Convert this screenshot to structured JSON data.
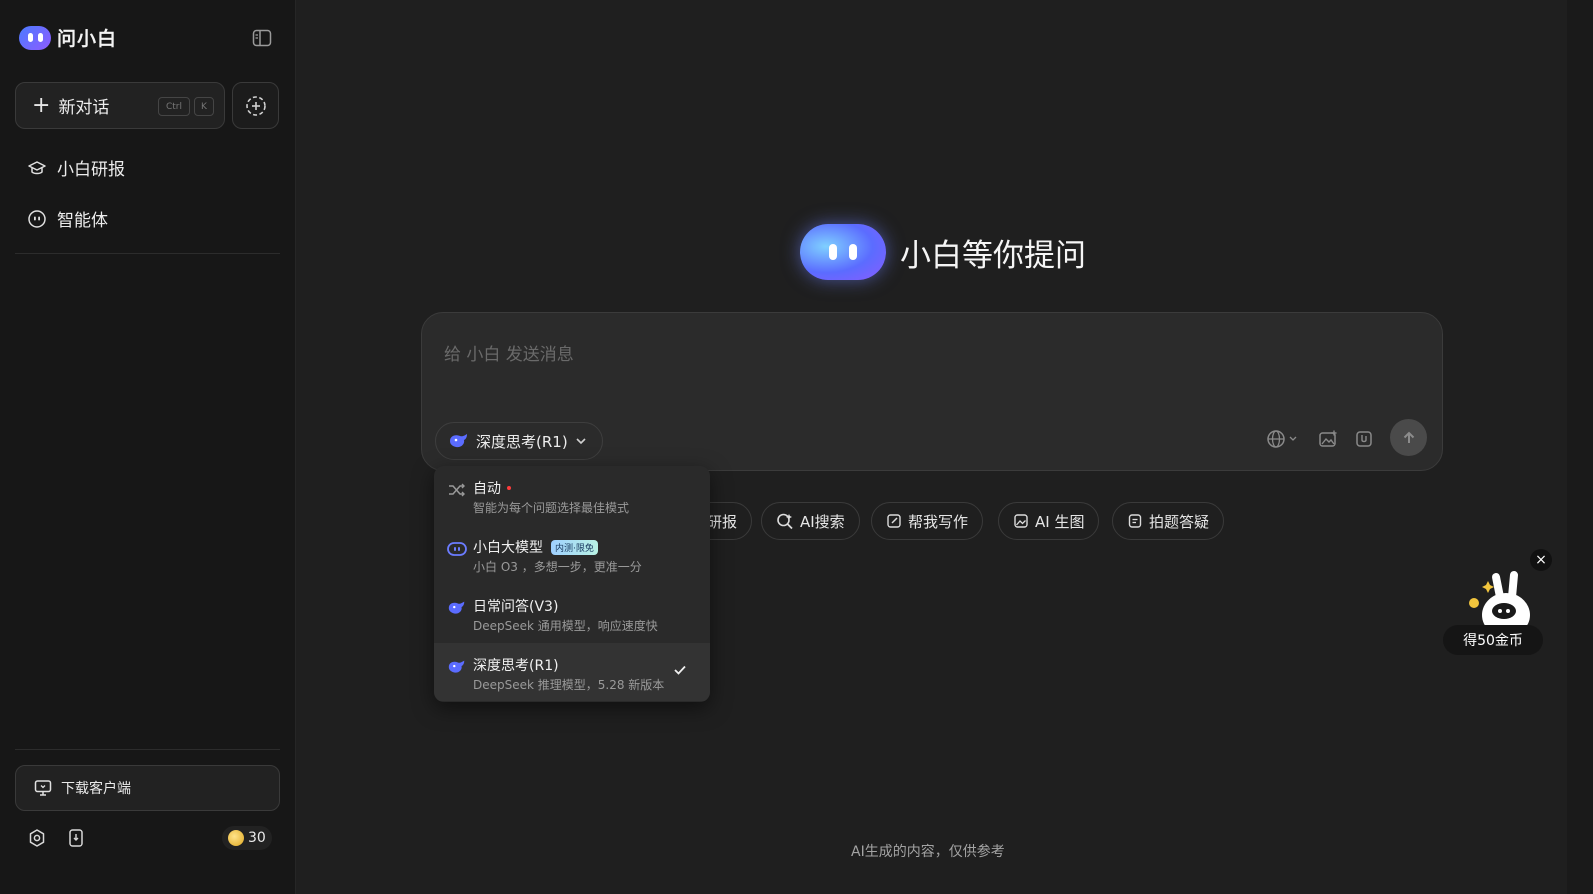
{
  "app": {
    "name": "问小白"
  },
  "sidebar": {
    "new_chat": {
      "label": "新对话",
      "shortcut_ctrl": "Ctrl",
      "shortcut_key": "K"
    },
    "items": [
      {
        "label": "小白研报",
        "icon": "graduation-cap-icon"
      },
      {
        "label": "智能体",
        "icon": "agent-face-icon"
      }
    ],
    "download_label": "下载客户端",
    "coins": "30"
  },
  "main": {
    "hero_title": "小白等你提问",
    "input_placeholder": "给 小白 发送消息",
    "selected_model": "深度思考(R1)",
    "chips": [
      "研报",
      "AI搜索",
      "帮我写作",
      "AI 生图",
      "拍题答疑"
    ],
    "footer_note": "AI生成的内容，仅供参考"
  },
  "model_menu": {
    "options": [
      {
        "title": "自动",
        "desc": "智能为每个问题选择最佳模式",
        "icon": "shuffle-icon",
        "new_dot": true
      },
      {
        "title": "小白大模型",
        "badge": "内测·限免",
        "desc": "小白 O3 ，多想一步，更准一分",
        "icon": "xiaobai-logo-icon"
      },
      {
        "title": "日常问答(V3)",
        "desc": "DeepSeek 通用模型，响应速度快",
        "icon": "deepseek-whale-icon"
      },
      {
        "title": "深度思考(R1)",
        "desc": "DeepSeek 推理模型，5.28 新版本",
        "icon": "deepseek-whale-icon",
        "selected": true
      }
    ]
  },
  "promo": {
    "label": "得50金币"
  },
  "colors": {
    "accent": "#5b6cff",
    "background": "#1f1f1f",
    "sidebar": "#171717"
  }
}
